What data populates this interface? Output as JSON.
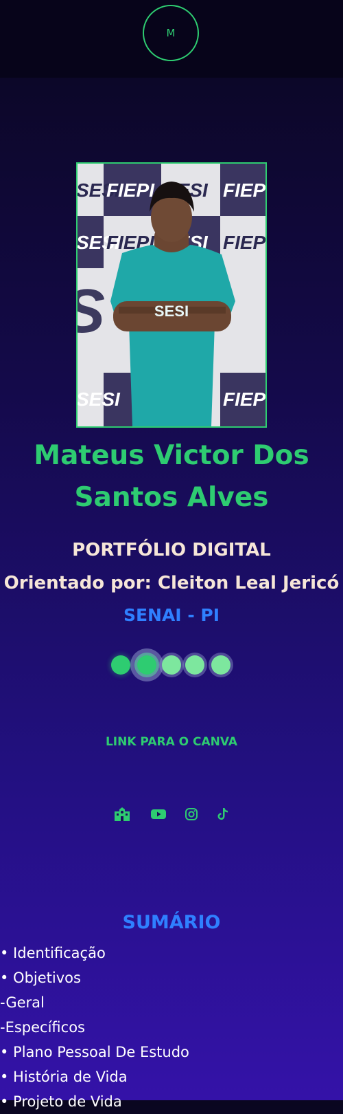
{
  "header": {
    "logo_letter": "M"
  },
  "profile": {
    "name_line1": "Mateus Victor Dos",
    "name_line2": "Santos Alves",
    "subtitle": "PORTFÓLIO DIGITAL",
    "advisor": "Orientado por: Cleiton Leal Jericó",
    "school": "SENAI - PI"
  },
  "photo_backdrop": {
    "brand_a": "SESI",
    "brand_b": "FIEPI",
    "shirt_text": "SESI"
  },
  "link": {
    "label": "LINK PARA O CANVA"
  },
  "social": {
    "icons": [
      "school-icon",
      "youtube-icon",
      "instagram-icon",
      "tiktok-icon"
    ]
  },
  "summary": {
    "title": "SUMÁRIO",
    "items": [
      "• Identificação",
      "• Objetivos",
      "-Geral",
      "-Específicos",
      "• Plano Pessoal De Estudo",
      "• História de Vida",
      "• Projeto de Vida"
    ]
  },
  "colors": {
    "accent": "#2ecc71",
    "blue": "#2f80ff",
    "cream": "#f6e6d8"
  }
}
